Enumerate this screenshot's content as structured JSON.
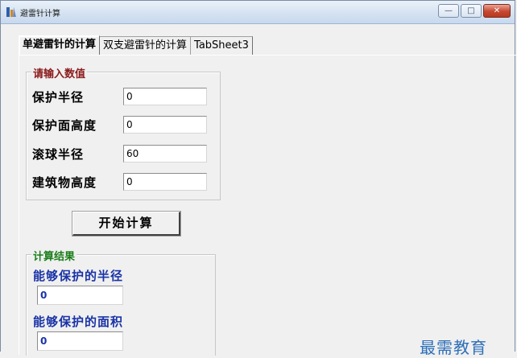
{
  "window": {
    "title": "避雷针计算",
    "min_glyph": "—",
    "max_glyph": "□",
    "close_glyph": "✕"
  },
  "tabs": [
    {
      "label": "单避雷针的计算",
      "active": true
    },
    {
      "label": "双支避雷针的计算",
      "active": false
    },
    {
      "label": "TabSheet3",
      "active": false
    }
  ],
  "input_group": {
    "title": "请输入数值",
    "fields": [
      {
        "label": "保护半径",
        "value": "0"
      },
      {
        "label": "保护面高度",
        "value": "0"
      },
      {
        "label": "滚球半径",
        "value": "60"
      },
      {
        "label": "建筑物高度",
        "value": "0"
      }
    ]
  },
  "start_button": {
    "label": "开始计算"
  },
  "result_group": {
    "title": "计算结果",
    "items": [
      {
        "label": "能够保护的半径",
        "value": "0"
      },
      {
        "label": "能够保护的面积",
        "value": "0"
      }
    ]
  },
  "watermark": "最需教育",
  "colors": {
    "input_title": "#8b1a1a",
    "result_title": "#1a7d1a",
    "result_text": "#1a33a6",
    "watermark": "#2d6fb8"
  }
}
